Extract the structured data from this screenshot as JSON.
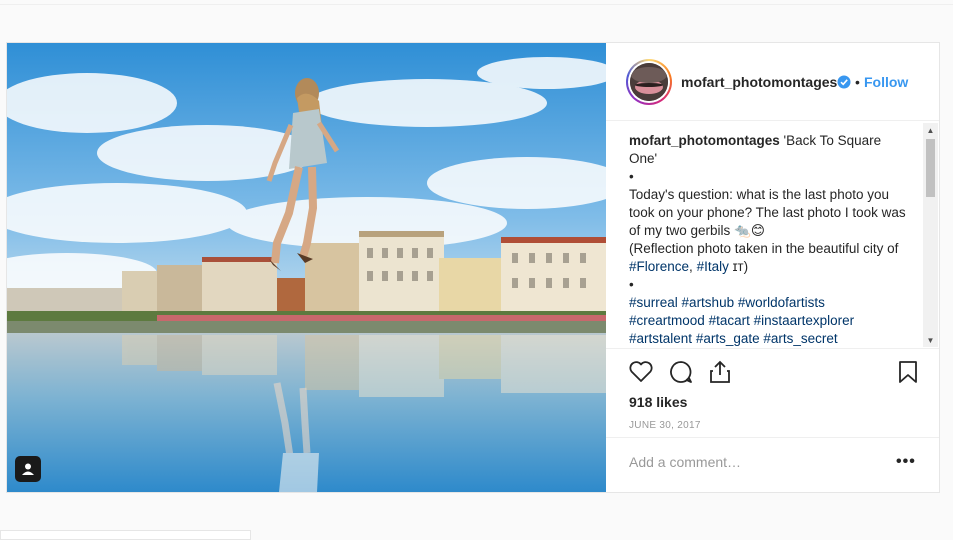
{
  "post": {
    "username": "mofart_photomontages",
    "verified": true,
    "separator": "•",
    "follow_label": "Follow",
    "caption": {
      "username": "mofart_photomontages",
      "lines": [
        {
          "text": " 'Back To Square One'",
          "inline_user": true
        },
        {
          "text": "•"
        },
        {
          "text": "Today's question: what is the last photo you took on your phone? The last photo I took was of my two gerbils 🐀😊"
        },
        {
          "text": "(Reflection photo taken in the beautiful city of "
        }
      ],
      "hashtags_city": [
        "#Florence",
        "#Italy"
      ],
      "city_suffix": " ɪᴛ)",
      "bullet2": "•",
      "hashtags": [
        "#surreal",
        "#artshub",
        "#worldofartists",
        "#creartmood",
        "#tacart",
        "#instaartexplorer",
        "#artstalent",
        "#arts_gate",
        "#arts_secret"
      ]
    },
    "likes": "918 likes",
    "date": "JUNE 30, 2017",
    "comment_placeholder": "Add a comment…",
    "more_label": "•••",
    "icons": {
      "like": "heart-icon",
      "comment": "comment-bubble-icon",
      "share": "share-icon",
      "save": "bookmark-icon",
      "tagged": "user-tag-icon",
      "verified": "verified-badge-icon"
    },
    "colors": {
      "link": "#3897f0",
      "hashtag": "#003569",
      "text": "#262626",
      "muted": "#999999"
    }
  }
}
